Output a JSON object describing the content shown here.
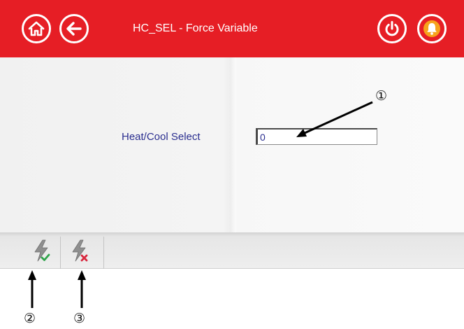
{
  "window": {
    "title": "HC_SEL - Force Variable",
    "accent_color": "#e61e25",
    "buttons": [
      {
        "name": "home",
        "icon": "home-icon"
      },
      {
        "name": "back",
        "icon": "back-arrow-icon"
      },
      {
        "name": "power",
        "icon": "power-icon"
      },
      {
        "name": "alarm",
        "icon": "bell-icon"
      }
    ]
  },
  "form": {
    "field_label": "Heat/Cool Select",
    "field_value": "0"
  },
  "toolbar": {
    "buttons": [
      {
        "name": "force-apply",
        "icon": "lightning-check-icon"
      },
      {
        "name": "force-cancel",
        "icon": "lightning-x-icon"
      }
    ]
  },
  "callouts": {
    "one": "①",
    "two": "②",
    "three": "③"
  }
}
